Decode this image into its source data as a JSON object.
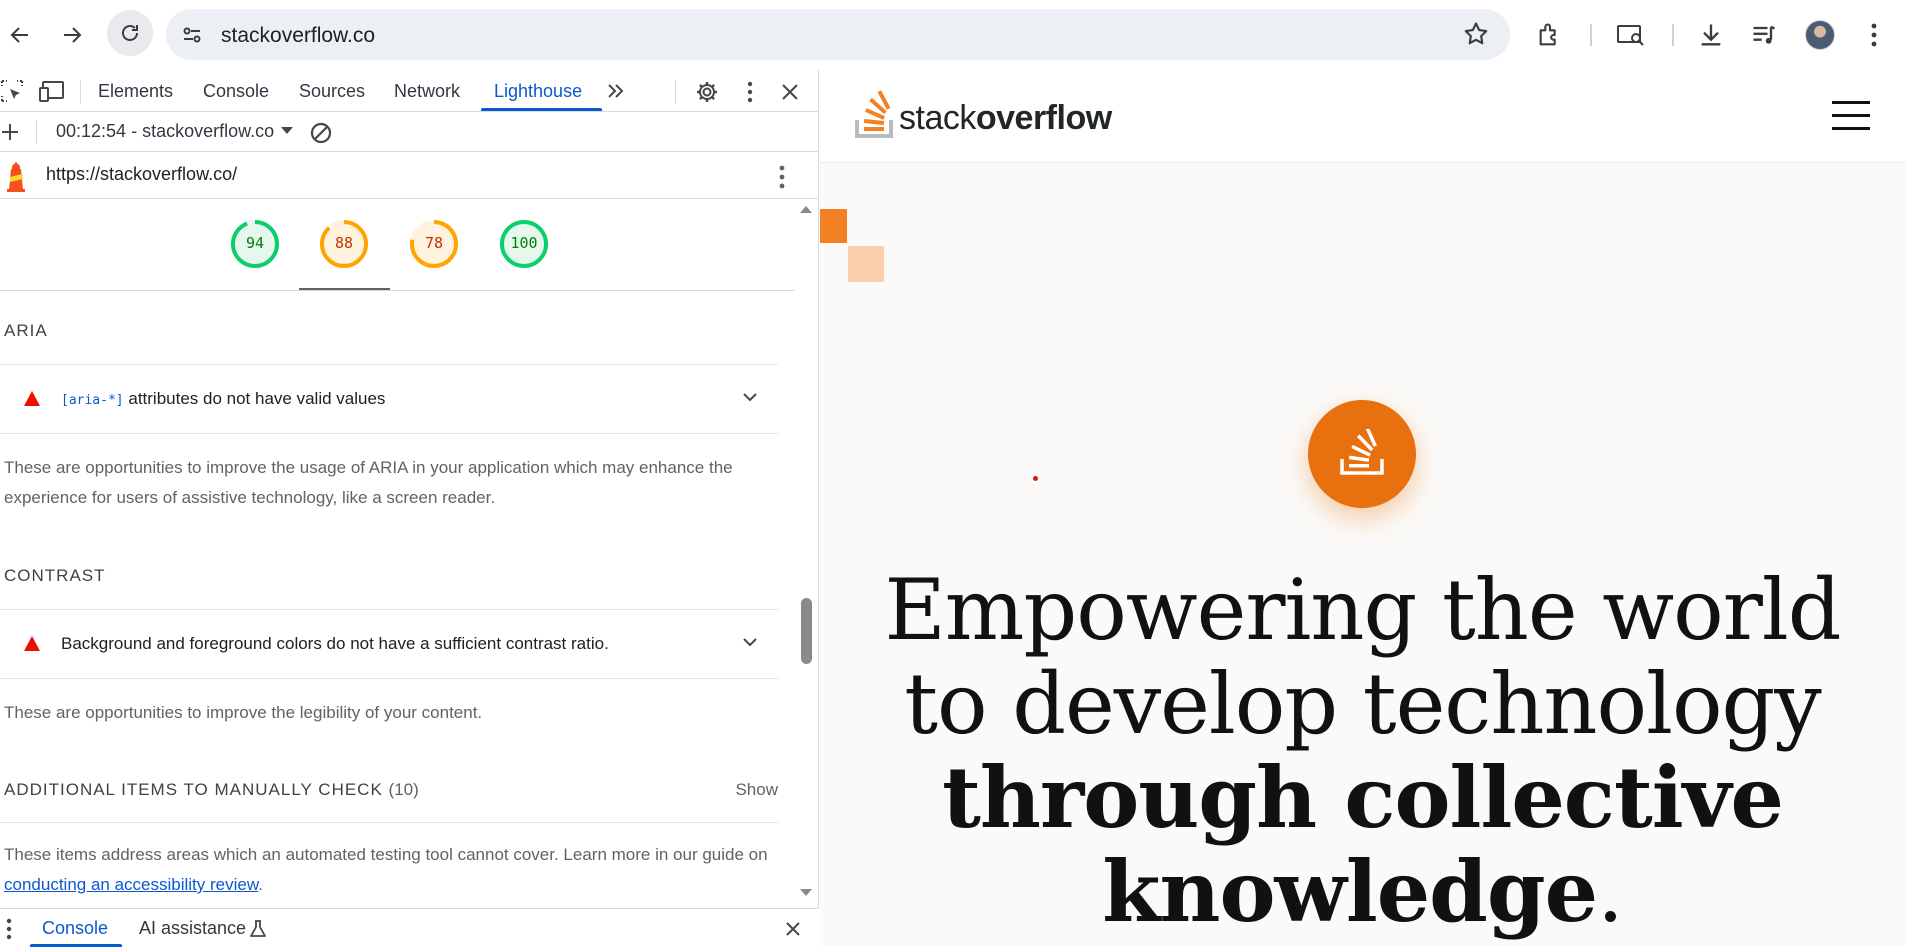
{
  "browser": {
    "url": "stackoverflow.co"
  },
  "devtools": {
    "tabs": [
      "Elements",
      "Console",
      "Sources",
      "Network",
      "Lighthouse"
    ],
    "active_tab": "Lighthouse",
    "report_label": "00:12:54 - stackoverflow.co",
    "audited_url": "https://stackoverflow.co/",
    "scores": [
      {
        "value": "94",
        "score": 94,
        "color": "#0cce6b",
        "text_color": "#008000",
        "bg": "#e6f8ee"
      },
      {
        "value": "88",
        "score": 88,
        "color": "#ffa400",
        "text_color": "#c33300",
        "bg": "#fff3e0"
      },
      {
        "value": "78",
        "score": 78,
        "color": "#ffa400",
        "text_color": "#c33300",
        "bg": "#fff3e0"
      },
      {
        "value": "100",
        "score": 100,
        "color": "#0cce6b",
        "text_color": "#008000",
        "bg": "#e6f8ee"
      }
    ],
    "sections": {
      "aria": {
        "title": "ARIA",
        "audit_code": "[aria-*]",
        "audit_title": "attributes do not have valid values",
        "description": "These are opportunities to improve the usage of ARIA in your application which may enhance the experience for users of assistive technology, like a screen reader."
      },
      "contrast": {
        "title": "CONTRAST",
        "audit_title": "Background and foreground colors do not have a sufficient contrast ratio.",
        "description": "These are opportunities to improve the legibility of your content."
      },
      "manual": {
        "title": "ADDITIONAL ITEMS TO MANUALLY CHECK",
        "count": "(10)",
        "show_label": "Show",
        "description": "These items address areas which an automated testing tool cannot cover. Learn more in our guide on ",
        "link": "conducting an accessibility review",
        "tail": "."
      }
    },
    "drawer": {
      "console": "Console",
      "ai": "AI assistance"
    }
  },
  "page": {
    "logo_light": "stack",
    "logo_bold": "overflow",
    "hero_line1": "Empowering the world",
    "hero_line2": "to develop technology",
    "hero_line3": "through collective",
    "hero_line4": "knowledge",
    "hero_period": ".",
    "brand_orange": "#f48024"
  }
}
